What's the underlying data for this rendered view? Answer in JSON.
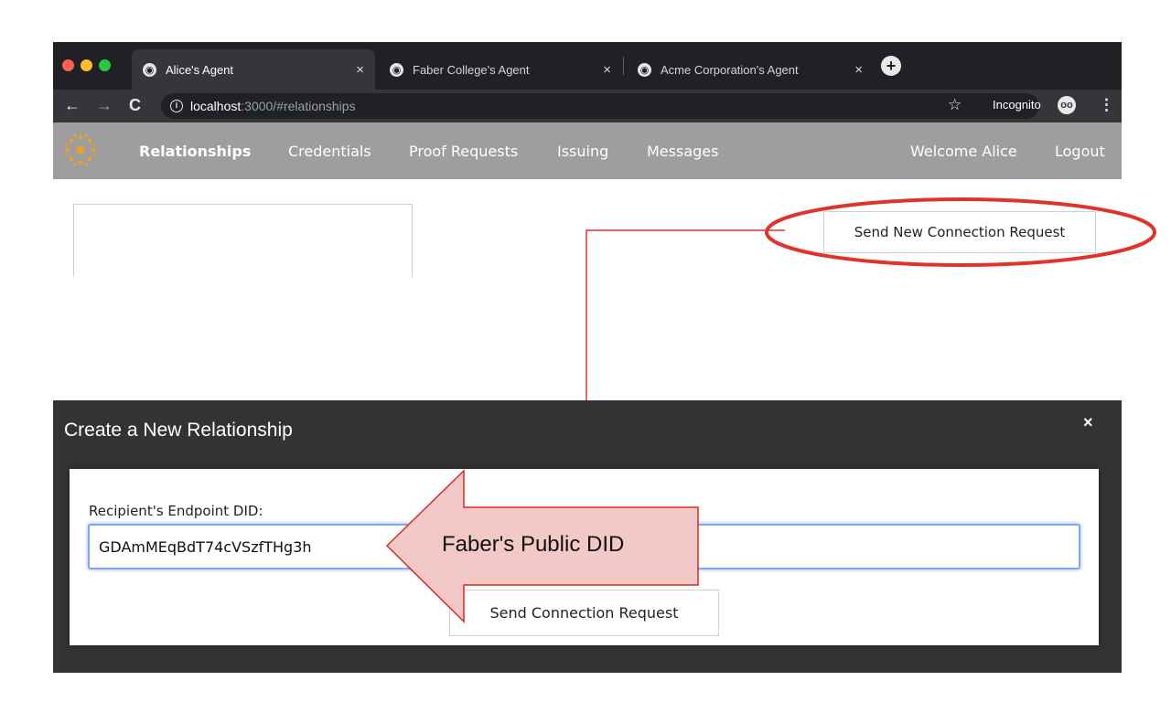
{
  "browser": {
    "tabs": [
      {
        "title": "Alice's Agent",
        "active": true
      },
      {
        "title": "Faber College's Agent",
        "active": false
      },
      {
        "title": "Acme Corporation's Agent",
        "active": false
      }
    ],
    "url_host": "localhost",
    "url_rest": ":3000/#relationships",
    "incognito_label": "Incognito",
    "icons": {
      "back": "back-arrow-icon",
      "forward": "forward-arrow-icon",
      "reload": "reload-icon",
      "info": "info-icon",
      "star": "star-icon",
      "menu": "kebab-menu-icon",
      "new_tab": "plus-icon",
      "incognito": "incognito-icon"
    }
  },
  "nav": {
    "items": [
      "Relationships",
      "Credentials",
      "Proof Requests",
      "Issuing",
      "Messages"
    ],
    "active": "Relationships",
    "welcome": "Welcome Alice",
    "logout": "Logout"
  },
  "page": {
    "send_new_request_label": "Send New Connection Request"
  },
  "modal": {
    "title": "Create a New Relationship",
    "close": "×",
    "field_label": "Recipient's Endpoint DID:",
    "field_value": "GDAmMEqBdT74cVSzfTHg3h",
    "submit_label": "Send Connection Request"
  },
  "annotation": {
    "callout_text": "Faber's Public DID",
    "highlight_color": "#e0342a",
    "arrow_fill": "#f2c9c7"
  },
  "colors": {
    "tab_bar": "#202124",
    "toolbar": "#35363a",
    "app_nav": "#9e9e9e",
    "modal_header": "#333333",
    "input_focus": "#7fa6ee"
  }
}
